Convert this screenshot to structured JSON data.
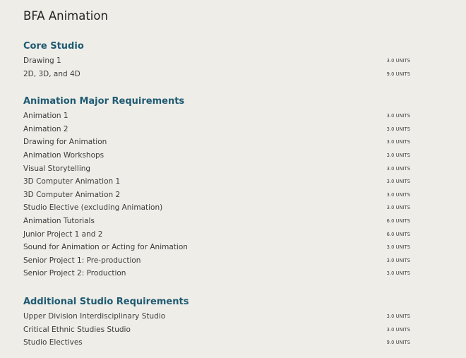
{
  "page": {
    "title": "BFA Animation"
  },
  "sections": [
    {
      "title": "Core Studio",
      "courses": [
        {
          "name": "Drawing 1",
          "units": "3.0 UNITS"
        },
        {
          "name": "2D, 3D, and 4D",
          "units": "9.0 UNITS"
        }
      ]
    },
    {
      "title": "Animation Major Requirements",
      "courses": [
        {
          "name": "Animation 1",
          "units": "3.0 UNITS"
        },
        {
          "name": "Animation 2",
          "units": "3.0 UNITS"
        },
        {
          "name": "Drawing for Animation",
          "units": "3.0 UNITS"
        },
        {
          "name": "Animation Workshops",
          "units": "3.0 UNITS"
        },
        {
          "name": "Visual Storytelling",
          "units": "3.0 UNITS"
        },
        {
          "name": "3D Computer Animation 1",
          "units": "3.0 UNITS"
        },
        {
          "name": "3D Computer Animation 2",
          "units": "3.0 UNITS"
        },
        {
          "name": "Studio Elective (excluding Animation)",
          "units": "3.0 UNITS"
        },
        {
          "name": "Animation Tutorials",
          "units": "6.0 UNITS"
        },
        {
          "name": "Junior Project 1 and 2",
          "units": "6.0 UNITS"
        },
        {
          "name": "Sound for Animation or Acting for Animation",
          "units": "3.0 UNITS"
        },
        {
          "name": "Senior Project 1: Pre-production",
          "units": "3.0 UNITS"
        },
        {
          "name": "Senior Project 2: Production",
          "units": "3.0 UNITS"
        }
      ]
    },
    {
      "title": "Additional Studio Requirements",
      "courses": [
        {
          "name": "Upper Division Interdisciplinary Studio",
          "units": "3.0 UNITS"
        },
        {
          "name": "Critical Ethnic Studies Studio",
          "units": "3.0 UNITS"
        },
        {
          "name": "Studio Electives",
          "units": "9.0 UNITS"
        }
      ]
    }
  ],
  "colors": {
    "background": "#eeede8",
    "section_heading": "#1f5a72",
    "text": "#3b3b3b"
  }
}
